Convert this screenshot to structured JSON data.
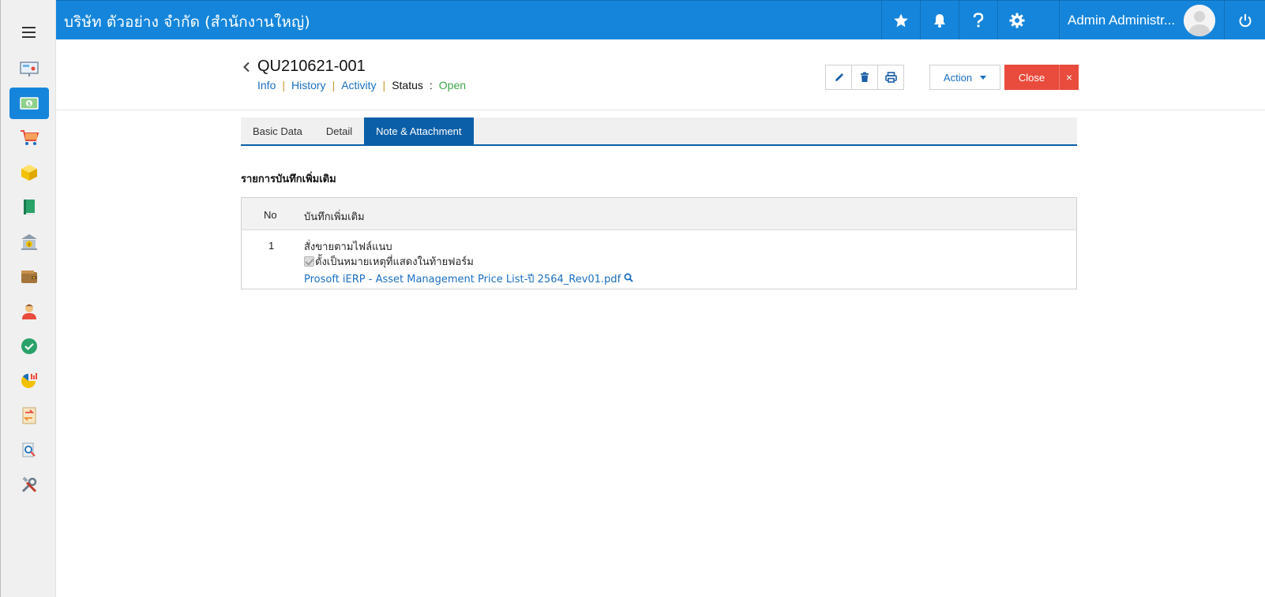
{
  "header": {
    "company": "บริษัท ตัวอย่าง จำกัด (สำนักงานใหญ่)",
    "user_name": "Admin Administr..."
  },
  "sidebar": {
    "icons": [
      "presentation-icon",
      "money-icon",
      "cart-icon",
      "box-icon",
      "book-icon",
      "bank-icon",
      "wallet-icon",
      "person-icon",
      "check-icon",
      "pie-chart-icon",
      "transfer-icon",
      "search-report-icon",
      "tools-icon"
    ],
    "active_index": 1
  },
  "document": {
    "number": "QU210621-001",
    "nav": {
      "info": "Info",
      "history": "History",
      "activity": "Activity",
      "status_label": "Status",
      "colon": ":",
      "status_value": "Open"
    }
  },
  "toolbar": {
    "action_label": "Action",
    "close_label": "Close",
    "close_x": "×"
  },
  "tabs": [
    "Basic Data",
    "Detail",
    "Note & Attachment"
  ],
  "active_tab": 2,
  "section": {
    "title": "รายการบันทึกเพิ่มเติม"
  },
  "table": {
    "headers": {
      "no": "No",
      "note": "บันทึกเพิ่มเติม"
    },
    "rows": [
      {
        "no": "1",
        "note": "สั่งขายตามไฟล์แนบ",
        "checkbox_label": "ตั้งเป็นหมายเหตุที่แสดงในท้ายฟอร์ม",
        "checked": true,
        "attachment": "Prosoft iERP - Asset Management Price List-ปี 2564_Rev01.pdf"
      }
    ]
  },
  "colors": {
    "header": "#1585db",
    "tab_active": "#0b5fa8",
    "close": "#e94b3c",
    "link": "#1a6fc0",
    "status_open": "#3aa74a"
  }
}
